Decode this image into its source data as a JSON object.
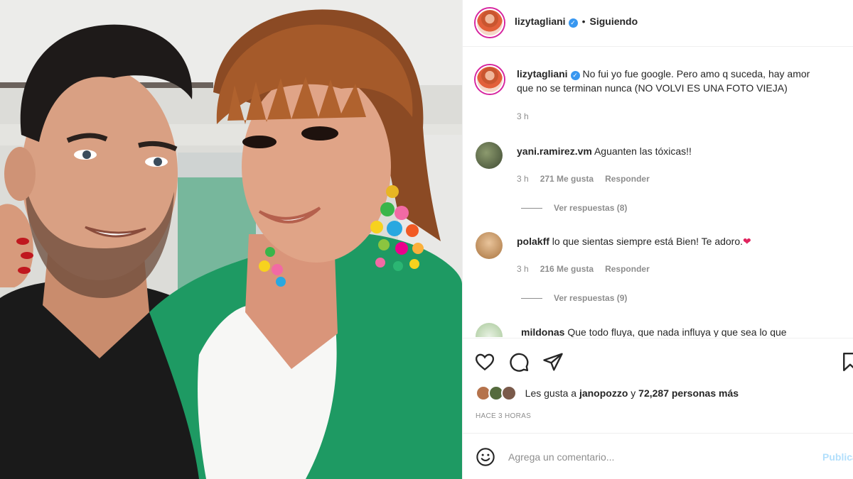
{
  "post": {
    "username": "lizytagliani",
    "verified_mark": "✓",
    "separator": "•",
    "follow_status": "Siguiendo"
  },
  "caption": {
    "username": "lizytagliani",
    "line1": "No fui yo fue google. Pero amo q suceda, hay amor",
    "line2": "que no se terminan nunca (NO VOLVI ES UNA FOTO VIEJA)",
    "time": "3 h"
  },
  "comments": [
    {
      "username": "yani.ramirez.vm",
      "text": "Aguanten las tóxicas!!",
      "time": "3 h",
      "likes": "271 Me gusta",
      "reply": "Responder",
      "view_replies": "Ver respuestas (8)",
      "avatar_color": "#5b6b4a"
    },
    {
      "username": "polakff",
      "text": "lo que sientas siempre está Bien! Te adoro.",
      "emoji": "❤",
      "time": "3 h",
      "likes": "216 Me gusta",
      "reply": "Responder",
      "view_replies": "Ver respuestas (9)",
      "avatar_color": "#c89a6a"
    },
    {
      "username": "mildonas",
      "text": "Que todo fluya, que nada influya y que sea lo que",
      "avatar_color": "#cfe2c7"
    }
  ],
  "actions": {
    "icons": [
      "heart-icon",
      "comment-icon",
      "share-icon",
      "bookmark-icon"
    ],
    "likes_prefix": "Les gusta a",
    "likes_user": "janopozzo",
    "likes_connector": "y",
    "likes_count": "72,287 personas más",
    "posted_ago": "HACE 3 HORAS"
  },
  "add_comment": {
    "placeholder": "Agrega un comentario...",
    "publish_label": "Publicar",
    "emoji_icon": "smiley-icon"
  },
  "colors": {
    "verified": "#3897f0",
    "muted": "#8e8e8e",
    "publish": "#b2dffc",
    "jacket": "#1e9a63",
    "heart": "#e0245e"
  }
}
